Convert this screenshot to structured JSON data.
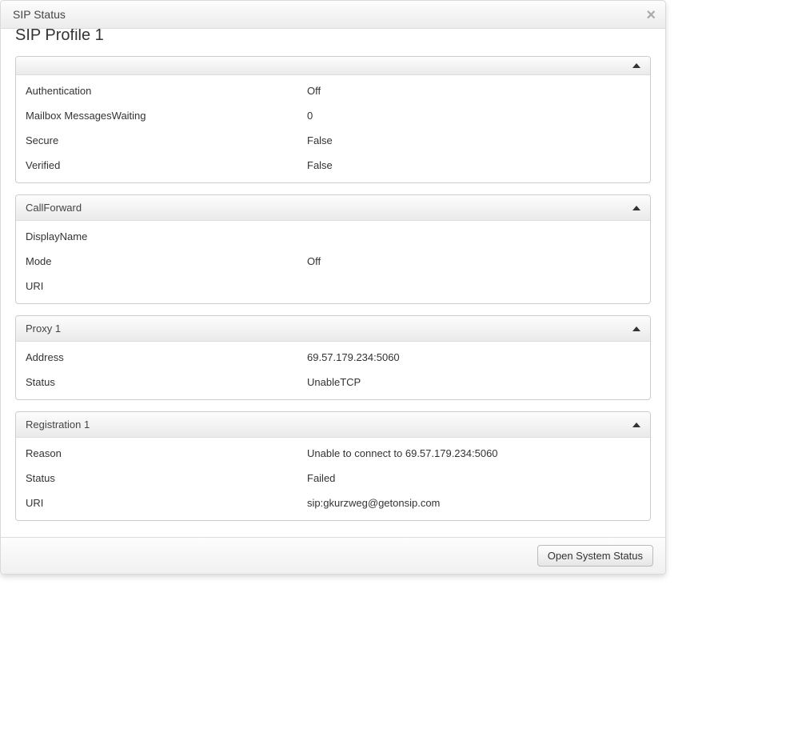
{
  "modal": {
    "title": "SIP Status",
    "close_label": "×"
  },
  "profile": {
    "title": "SIP Profile 1"
  },
  "panels": [
    {
      "id": "auth",
      "title": "",
      "rows": [
        {
          "label": "Authentication",
          "value": "Off"
        },
        {
          "label": "Mailbox MessagesWaiting",
          "value": "0"
        },
        {
          "label": "Secure",
          "value": "False"
        },
        {
          "label": "Verified",
          "value": "False"
        }
      ]
    },
    {
      "id": "callforward",
      "title": "CallForward",
      "rows": [
        {
          "label": "DisplayName",
          "value": ""
        },
        {
          "label": "Mode",
          "value": "Off"
        },
        {
          "label": "URI",
          "value": ""
        }
      ]
    },
    {
      "id": "proxy1",
      "title": "Proxy 1",
      "rows": [
        {
          "label": "Address",
          "value": "69.57.179.234:5060"
        },
        {
          "label": "Status",
          "value": "UnableTCP"
        }
      ]
    },
    {
      "id": "registration1",
      "title": "Registration 1",
      "rows": [
        {
          "label": "Reason",
          "value": "Unable to connect to 69.57.179.234:5060"
        },
        {
          "label": "Status",
          "value": "Failed"
        },
        {
          "label": "URI",
          "value": "sip:gkurzweg@getonsip.com"
        }
      ]
    }
  ],
  "footer": {
    "open_system_status": "Open System Status"
  }
}
